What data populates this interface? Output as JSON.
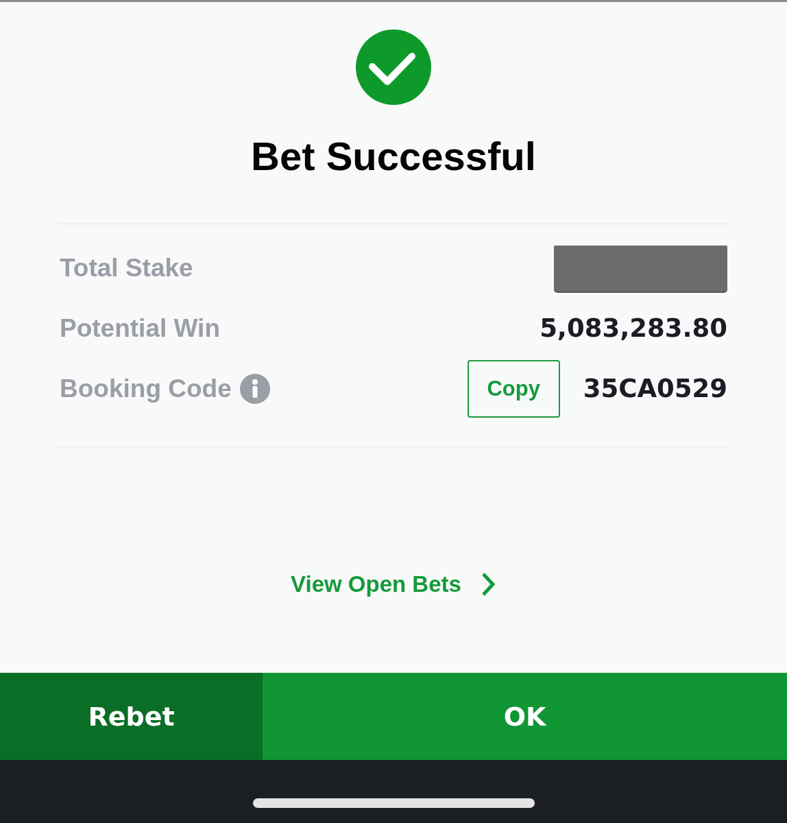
{
  "header": {
    "title": "Bet Successful"
  },
  "summary": [
    {
      "label": "Total Stake",
      "redacted": true
    },
    {
      "label": "Potential Win",
      "value": "5,083,283.80"
    },
    {
      "label": "Booking Code",
      "info_icon": true,
      "copy_button": "Copy",
      "value": "35CA0529"
    }
  ],
  "link": {
    "label": "View Open Bets"
  },
  "actions": [
    {
      "kind": "secondary",
      "label": "Rebet"
    },
    {
      "kind": "primary",
      "label": "OK"
    }
  ]
}
